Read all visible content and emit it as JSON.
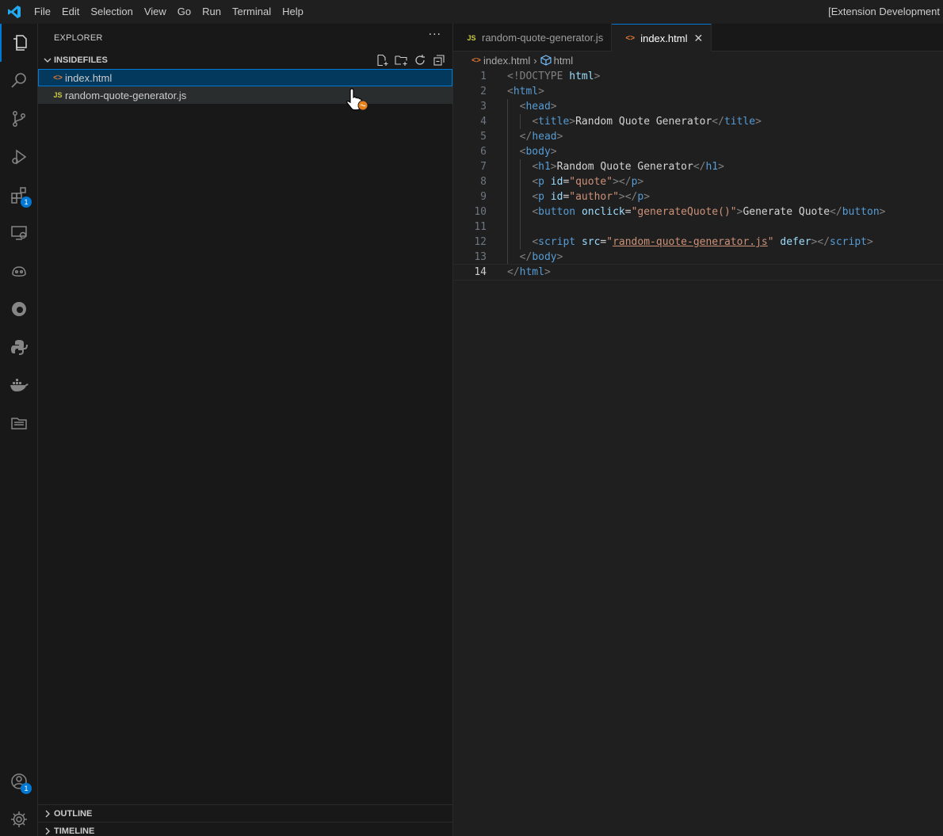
{
  "menu": [
    "File",
    "Edit",
    "Selection",
    "View",
    "Go",
    "Run",
    "Terminal",
    "Help"
  ],
  "window_title": "[Extension Development",
  "activity": {
    "extensions_badge": "1",
    "accounts_badge": "1"
  },
  "sidebar": {
    "title": "EXPLORER",
    "more": "···",
    "folder": "INSIDEFILES",
    "files": [
      {
        "icon": "<>",
        "name": "index.html"
      },
      {
        "icon": "JS",
        "name": "random-quote-generator.js"
      }
    ],
    "outline": "OUTLINE",
    "timeline": "TIMELINE"
  },
  "tabs": [
    {
      "icon": "JS",
      "label": "random-quote-generator.js"
    },
    {
      "icon": "<>",
      "label": "index.html",
      "close": "✕"
    }
  ],
  "breadcrumb": {
    "file": "index.html",
    "symbol": "html"
  },
  "code": {
    "line_numbers": [
      "1",
      "2",
      "3",
      "4",
      "5",
      "6",
      "7",
      "8",
      "9",
      "10",
      "11",
      "12",
      "13",
      "14"
    ],
    "lines": [
      [
        {
          "c": "t-tag",
          "t": "<!DOCTYPE "
        },
        {
          "c": "t-attr",
          "t": "html"
        },
        {
          "c": "t-tag",
          "t": ">"
        }
      ],
      [
        {
          "c": "t-tag",
          "t": "<"
        },
        {
          "c": "t-name",
          "t": "html"
        },
        {
          "c": "t-tag",
          "t": ">"
        }
      ],
      [
        {
          "c": "t-text",
          "t": "  "
        },
        {
          "c": "t-tag",
          "t": "<"
        },
        {
          "c": "t-name",
          "t": "head"
        },
        {
          "c": "t-tag",
          "t": ">"
        }
      ],
      [
        {
          "c": "t-text",
          "t": "    "
        },
        {
          "c": "t-tag",
          "t": "<"
        },
        {
          "c": "t-name",
          "t": "title"
        },
        {
          "c": "t-tag",
          "t": ">"
        },
        {
          "c": "t-text",
          "t": "Random Quote Generator"
        },
        {
          "c": "t-tag",
          "t": "</"
        },
        {
          "c": "t-name",
          "t": "title"
        },
        {
          "c": "t-tag",
          "t": ">"
        }
      ],
      [
        {
          "c": "t-text",
          "t": "  "
        },
        {
          "c": "t-tag",
          "t": "</"
        },
        {
          "c": "t-name",
          "t": "head"
        },
        {
          "c": "t-tag",
          "t": ">"
        }
      ],
      [
        {
          "c": "t-text",
          "t": "  "
        },
        {
          "c": "t-tag",
          "t": "<"
        },
        {
          "c": "t-name",
          "t": "body"
        },
        {
          "c": "t-tag",
          "t": ">"
        }
      ],
      [
        {
          "c": "t-text",
          "t": "    "
        },
        {
          "c": "t-tag",
          "t": "<"
        },
        {
          "c": "t-name",
          "t": "h1"
        },
        {
          "c": "t-tag",
          "t": ">"
        },
        {
          "c": "t-text",
          "t": "Random Quote Generator"
        },
        {
          "c": "t-tag",
          "t": "</"
        },
        {
          "c": "t-name",
          "t": "h1"
        },
        {
          "c": "t-tag",
          "t": ">"
        }
      ],
      [
        {
          "c": "t-text",
          "t": "    "
        },
        {
          "c": "t-tag",
          "t": "<"
        },
        {
          "c": "t-name",
          "t": "p"
        },
        {
          "c": "t-text",
          "t": " "
        },
        {
          "c": "t-attr",
          "t": "id"
        },
        {
          "c": "t-text",
          "t": "="
        },
        {
          "c": "t-str",
          "t": "\"quote\""
        },
        {
          "c": "t-tag",
          "t": "></"
        },
        {
          "c": "t-name",
          "t": "p"
        },
        {
          "c": "t-tag",
          "t": ">"
        }
      ],
      [
        {
          "c": "t-text",
          "t": "    "
        },
        {
          "c": "t-tag",
          "t": "<"
        },
        {
          "c": "t-name",
          "t": "p"
        },
        {
          "c": "t-text",
          "t": " "
        },
        {
          "c": "t-attr",
          "t": "id"
        },
        {
          "c": "t-text",
          "t": "="
        },
        {
          "c": "t-str",
          "t": "\"author\""
        },
        {
          "c": "t-tag",
          "t": "></"
        },
        {
          "c": "t-name",
          "t": "p"
        },
        {
          "c": "t-tag",
          "t": ">"
        }
      ],
      [
        {
          "c": "t-text",
          "t": "    "
        },
        {
          "c": "t-tag",
          "t": "<"
        },
        {
          "c": "t-name",
          "t": "button"
        },
        {
          "c": "t-text",
          "t": " "
        },
        {
          "c": "t-attr",
          "t": "onclick"
        },
        {
          "c": "t-text",
          "t": "="
        },
        {
          "c": "t-str",
          "t": "\"generateQuote()\""
        },
        {
          "c": "t-tag",
          "t": ">"
        },
        {
          "c": "t-text",
          "t": "Generate Quote"
        },
        {
          "c": "t-tag",
          "t": "</"
        },
        {
          "c": "t-name",
          "t": "button"
        },
        {
          "c": "t-tag",
          "t": ">"
        }
      ],
      [],
      [
        {
          "c": "t-text",
          "t": "    "
        },
        {
          "c": "t-tag",
          "t": "<"
        },
        {
          "c": "t-name",
          "t": "script"
        },
        {
          "c": "t-text",
          "t": " "
        },
        {
          "c": "t-attr",
          "t": "src"
        },
        {
          "c": "t-text",
          "t": "="
        },
        {
          "c": "t-str",
          "t": "\""
        },
        {
          "c": "t-str t-link",
          "t": "random-quote-generator.js"
        },
        {
          "c": "t-str",
          "t": "\""
        },
        {
          "c": "t-text",
          "t": " "
        },
        {
          "c": "t-attr",
          "t": "defer"
        },
        {
          "c": "t-tag",
          "t": "></"
        },
        {
          "c": "t-name",
          "t": "script"
        },
        {
          "c": "t-tag",
          "t": ">"
        }
      ],
      [
        {
          "c": "t-text",
          "t": "  "
        },
        {
          "c": "t-tag",
          "t": "</"
        },
        {
          "c": "t-name",
          "t": "body"
        },
        {
          "c": "t-tag",
          "t": ">"
        }
      ],
      [
        {
          "c": "t-tag",
          "t": "</"
        },
        {
          "c": "t-name",
          "t": "html"
        },
        {
          "c": "t-tag",
          "t": ">"
        }
      ]
    ],
    "current_line": 14
  },
  "colors": {
    "accent": "#0078d4",
    "html_icon": "#e37933",
    "js_icon": "#cbcb41"
  },
  "icons": [
    "vscode-logo-icon",
    "explorer-icon",
    "search-icon",
    "source-control-icon",
    "run-debug-icon",
    "extensions-icon",
    "remote-explorer-icon",
    "copilot-icon",
    "edge-icon",
    "python-icon",
    "docker-icon",
    "project-manager-icon",
    "accounts-icon",
    "settings-gear-icon",
    "new-file-icon",
    "new-folder-icon",
    "refresh-icon",
    "collapse-all-icon",
    "hand-cursor-icon"
  ]
}
